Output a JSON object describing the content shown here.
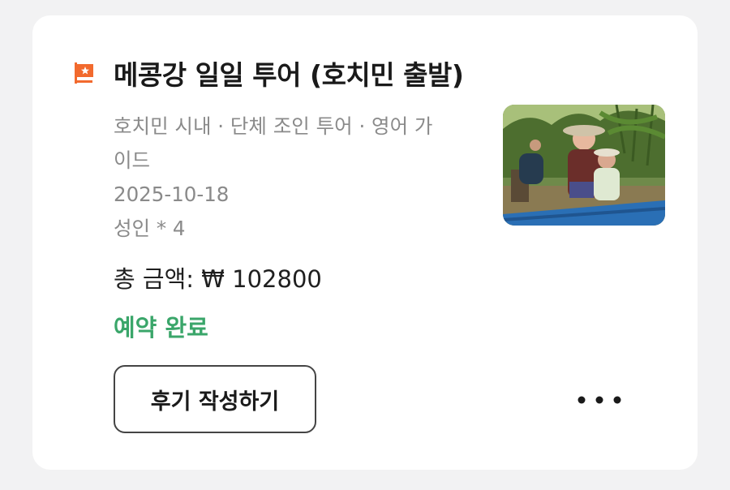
{
  "booking": {
    "title": "메콩강 일일 투어 (호치민 출발)",
    "detail_line1": "호치민 시내 · 단체 조인 투어 · 영어 가",
    "detail_line2": "이드",
    "date": "2025-10-18",
    "guests": "성인 * 4",
    "total": "총 금액: ₩ 102800",
    "status": "예약 완료",
    "status_color": "#3aa66a",
    "flag_icon": "flag-icon",
    "thumbnail_icon": "tour-photo"
  },
  "actions": {
    "review_label": "후기 작성하기",
    "more_icon": "more-horizontal-icon"
  }
}
